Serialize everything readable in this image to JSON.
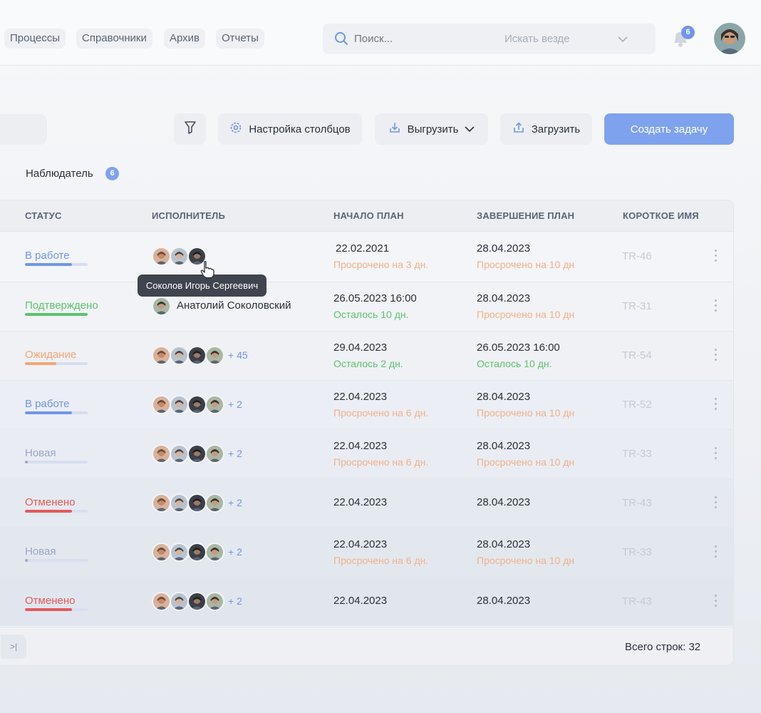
{
  "colors": {
    "accent": "#7fa2ee",
    "status_in_work": "#6f96e8",
    "status_confirmed": "#5cc26e",
    "status_waiting": "#f2a775",
    "status_new": "#9aa6c4",
    "status_canceled": "#e45a5a",
    "overdue": "#f2b08a",
    "remaining": "#5cc26e"
  },
  "nav": {
    "items": [
      "Процессы",
      "Справочники",
      "Архив",
      "Отчеты"
    ],
    "search_placeholder": "Поиск...",
    "search_scope": "Искать везде",
    "notifications_count": "6"
  },
  "toolbar": {
    "columns_label": "Настройка столбцов",
    "export_label": "Выгрузить",
    "import_label": "Загрузить",
    "create_label": "Создать задачу"
  },
  "tabs": {
    "observer_label": "Наблюдатель",
    "observer_count": "6"
  },
  "table": {
    "headers": {
      "status": "СТАТУС",
      "assignee": "ИСПОЛНИТЕЛЬ",
      "start": "НАЧАЛО ПЛАН",
      "end": "ЗАВЕРШЕНИЕ ПЛАН",
      "short": "КОРОТКОЕ ИМЯ"
    },
    "rows": [
      {
        "status": "В работе",
        "progress": 0.75,
        "more": "",
        "name": "",
        "start": "22.02.2021",
        "start_note": "Просрочено на 3 дн.",
        "end": "28.04.2023",
        "end_note": "Просрочено на 10 дн",
        "short": "TR-46"
      },
      {
        "status": "Подтверждено",
        "progress": 1.0,
        "more": "",
        "name": "Анатолий Соколовский",
        "start": "26.05.2023 16:00",
        "start_note": "Осталось 10 дн.",
        "end": "28.04.2023",
        "end_note": "Просрочено на 10 дн",
        "short": "TR-31"
      },
      {
        "status": "Ожидание",
        "progress": 0.5,
        "more": "+ 45",
        "name": "",
        "start": "29.04.2023",
        "start_note": "Осталось 2 дн.",
        "end": "26.05.2023 16:00",
        "end_note": "Осталось 10 дн.",
        "short": "TR-54"
      },
      {
        "status": "В работе",
        "progress": 0.75,
        "more": "+ 2",
        "name": "",
        "start": "22.04.2023",
        "start_note": "Просрочено на 6 дн.",
        "end": "28.04.2023",
        "end_note": "Просрочено на 10 дн",
        "short": "TR-52"
      },
      {
        "status": "Новая",
        "progress": 0.05,
        "more": "+ 2",
        "name": "",
        "start": "22.04.2023",
        "start_note": "Просрочено на 6 дн.",
        "end": "28.04.2023",
        "end_note": "Просрочено на 10 дн",
        "short": "TR-33"
      },
      {
        "status": "Отменено",
        "progress": 0.75,
        "more": "+ 2",
        "name": "",
        "start": "22.04.2023",
        "start_note": "",
        "end": "28.04.2023",
        "end_note": "",
        "short": "TR-43"
      },
      {
        "status": "Новая",
        "progress": 0.05,
        "more": "+ 2",
        "name": "",
        "start": "22.04.2023",
        "start_note": "Просрочено на 6 дн.",
        "end": "28.04.2023",
        "end_note": "Просрочено на 10 дн",
        "short": "TR-33"
      },
      {
        "status": "Отменено",
        "progress": 0.75,
        "more": "+ 2",
        "name": "",
        "start": "22.04.2023",
        "start_note": "",
        "end": "28.04.2023",
        "end_note": "",
        "short": "TR-43"
      }
    ],
    "total_label": "Всего строк: 32"
  },
  "tooltip": {
    "text": "Соколов Игорь Сергеевич"
  }
}
